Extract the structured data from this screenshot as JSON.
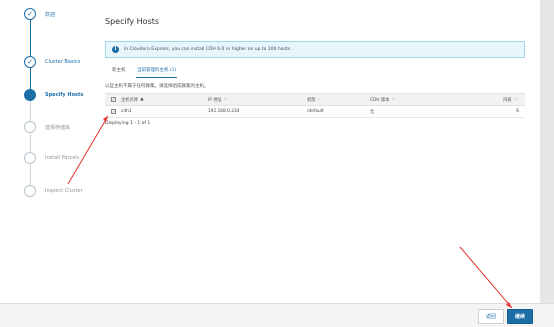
{
  "wizard": {
    "steps": [
      {
        "label": "欢迎",
        "state": "done"
      },
      {
        "label": "Cluster Basics",
        "state": "done"
      },
      {
        "label": "Specify Hosts",
        "state": "active"
      },
      {
        "label": "选择存储库",
        "state": "pending"
      },
      {
        "label": "Install Parcels",
        "state": "pending"
      },
      {
        "label": "Inspect Cluster",
        "state": "pending"
      }
    ],
    "done_icon": "check-icon"
  },
  "main": {
    "title": "Specify Hosts",
    "info": {
      "icon": "info-icon",
      "text": "In Cloudera Express, you can install CDH 6.0 or higher on up to 100 hosts."
    },
    "tabs": [
      {
        "label": "新主机",
        "active": false
      },
      {
        "label": "当前管理的主机 (1)",
        "active": true
      }
    ],
    "hint": "以些主机不属于任何群集。请选择组成群集的主机。",
    "table": {
      "select_all_checked": true,
      "columns": [
        {
          "label": "主机名称",
          "sort": "▲"
        },
        {
          "label": "IP 地址",
          "sort": "◇"
        },
        {
          "label": "机架",
          "sort": "◇"
        },
        {
          "label": "CDH 版本",
          "sort": "◇"
        },
        {
          "label": "内核",
          "sort": "◇"
        }
      ],
      "rows": [
        {
          "checked": true,
          "host": "cdh1",
          "ip": "192.168.0.234",
          "rack": "/default",
          "cdh": "无",
          "cores": "6"
        }
      ]
    },
    "paging": "Displaying 1 - 1 of 1"
  },
  "footer": {
    "back_label": "返回",
    "next_label": "继续"
  },
  "colors": {
    "accent": "#1b6ea8",
    "annotation_arrow": "#e8312a",
    "info_bg": "#e8f6fb"
  }
}
